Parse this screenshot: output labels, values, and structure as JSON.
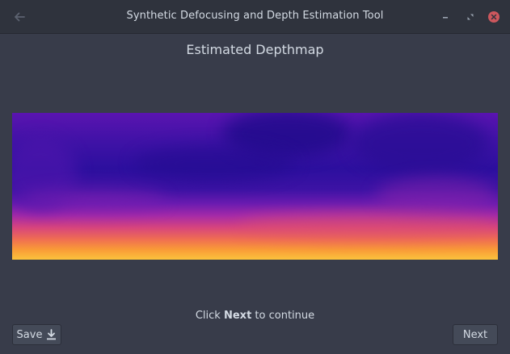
{
  "window": {
    "title": "Synthetic Defocusing and Depth Estimation Tool"
  },
  "icons": {
    "back": "arrow-left-icon",
    "minimize": "minimize-icon",
    "maximize": "maximize-icon",
    "close": "close-icon",
    "save": "download-icon"
  },
  "main": {
    "heading": "Estimated Depthmap",
    "hint_prefix": "Click",
    "hint_bold": "Next",
    "hint_suffix": "to continue"
  },
  "buttons": {
    "save_label": "Save",
    "next_label": "Next"
  },
  "colors": {
    "window_bg": "#383c4a",
    "titlebar_bg": "#2f333d",
    "close_red": "#cc575d",
    "text": "#d3dae3"
  }
}
